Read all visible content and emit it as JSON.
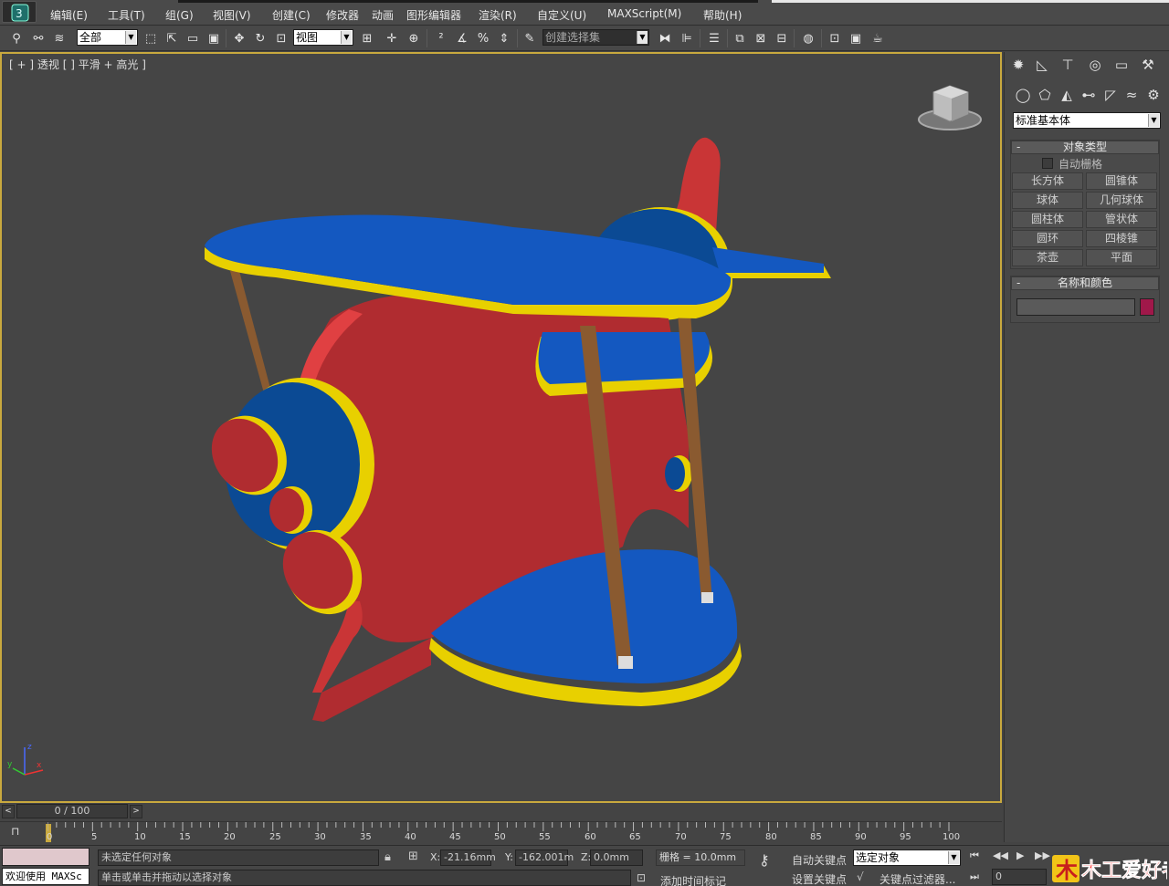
{
  "menu": [
    "编辑(E)",
    "工具(T)",
    "组(G)",
    "视图(V)",
    "创建(C)",
    "修改器",
    "动画",
    "图形编辑器",
    "渲染(R)",
    "自定义(U)",
    "MAXScript(M)",
    "帮助(H)"
  ],
  "toolbar": {
    "selection_filter": "全部",
    "reference_coord": "视图",
    "named_selection": "创建选择集"
  },
  "viewport": {
    "label": "[ + ] 透视 [ ] 平滑 + 高光 ]",
    "label_parts": [
      "[ + ]",
      "透视",
      "[ ]",
      "平滑 + 高光",
      "]"
    ]
  },
  "command_panel": {
    "category": "标准基本体",
    "object_type": {
      "title": "对象类型",
      "autogrid_label": "自动栅格",
      "buttons": [
        "长方体",
        "圆锥体",
        "球体",
        "几何球体",
        "圆柱体",
        "管状体",
        "圆环",
        "四棱锥",
        "茶壶",
        "平面"
      ]
    },
    "name_color": {
      "title": "名称和颜色",
      "name_value": "",
      "color": "#a0184a"
    }
  },
  "timeline": {
    "slider_label": "0 / 100",
    "ticks": [
      "0",
      "5",
      "10",
      "15",
      "20",
      "25",
      "30",
      "35",
      "40",
      "45",
      "50",
      "55",
      "60",
      "65",
      "70",
      "75",
      "80",
      "85",
      "90",
      "95",
      "100"
    ]
  },
  "status": {
    "welcome": "欢迎使用 MAXSc",
    "selection_status": "未选定任何对象",
    "prompt": "单击或单击并拖动以选择对象",
    "x_label": "X:",
    "x_value": "-21.16mm",
    "y_label": "Y:",
    "y_value": "-162.001m",
    "z_label": "Z:",
    "z_value": "0.0mm",
    "grid": "栅格 = 10.0mm",
    "add_time_tag": "添加时间标记",
    "auto_key": "自动关键点",
    "set_key": "设置关键点",
    "selected_objects": "选定对象",
    "key_filters": "关键点过滤器...",
    "frame": "0"
  },
  "watermark": {
    "text": "木工爱好者"
  }
}
